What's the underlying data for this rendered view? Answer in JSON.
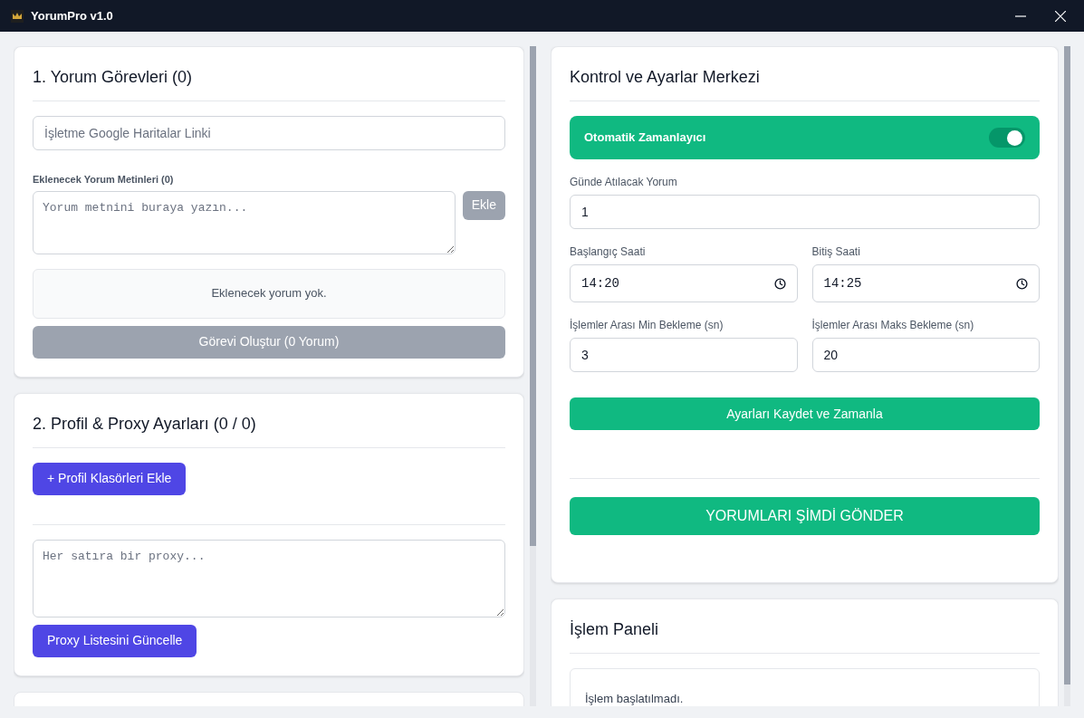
{
  "window": {
    "title": "YorumPro v1.0"
  },
  "tasks": {
    "title": "1. Yorum Görevleri (0)",
    "link_placeholder": "İşletme Google Haritalar Linki",
    "texts_label": "Eklenecek Yorum Metinleri (0)",
    "text_placeholder": "Yorum metnini buraya yazın...",
    "add_button": {
      "label": "Ekle",
      "disabled": true
    },
    "empty_message": "Eklenecek yorum yok.",
    "create_button": {
      "label": "Görevi Oluştur (0 Yorum)",
      "disabled": true
    }
  },
  "profiles": {
    "title": "2. Profil & Proxy Ayarları (0 / 0)",
    "add_folders_button": "+ Profil Klasörleri Ekle",
    "proxy_placeholder": "Her satıra bir proxy...",
    "update_proxy_button": "Proxy Listesini Güncelle"
  },
  "control": {
    "title": "Kontrol ve Ayarlar Merkezi",
    "scheduler": {
      "label": "Otomatik Zamanlayıcı",
      "on": true
    },
    "fields": [
      {
        "label": "Günde Atılacak Yorum",
        "value": "1",
        "kind": "text"
      },
      {
        "label": "Başlangıç Saati",
        "value": "14:20",
        "kind": "time"
      },
      {
        "label": "Bitiş Saati",
        "value": "14:25",
        "kind": "time"
      },
      {
        "label": "İşlemler Arası Min Bekleme (sn)",
        "value": "3",
        "kind": "text"
      },
      {
        "label": "İşlemler Arası Maks Bekleme (sn)",
        "value": "20",
        "kind": "text"
      }
    ],
    "save_button": "Ayarları Kaydet ve Zamanla",
    "send_button": "YORUMLARI ŞİMDİ GÖNDER"
  },
  "process": {
    "title": "İşlem Paneli",
    "log": "İşlem başlatılmadı."
  }
}
